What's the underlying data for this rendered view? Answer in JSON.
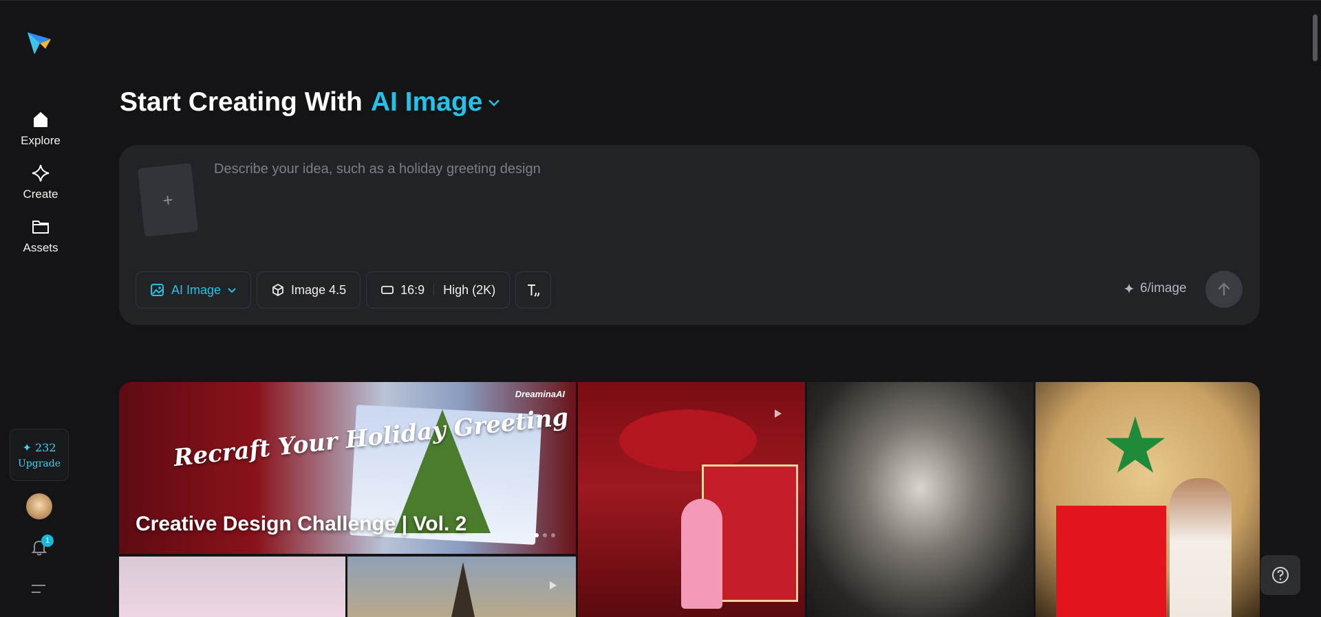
{
  "nav": {
    "items": [
      {
        "label": "Explore",
        "icon": "home-icon"
      },
      {
        "label": "Create",
        "icon": "sparkle-icon"
      },
      {
        "label": "Assets",
        "icon": "folder-icon"
      }
    ]
  },
  "account": {
    "credits": "✦ 232",
    "upgrade_label": "Upgrade",
    "notification_count": "1"
  },
  "header": {
    "title_prefix": "Start Creating With",
    "title_mode": "AI Image"
  },
  "composer": {
    "placeholder": "Describe your idea, such as a holiday greeting design",
    "upload_label": "+",
    "mode_label": "AI Image",
    "model_label": "Image 4.5",
    "ratio_label": "16:9",
    "quality_label": "High (2K)",
    "cost_label": "6/image"
  },
  "gallery": {
    "banner_script": "Recraft Your Holiday Greeting",
    "banner_brand": "DreaminaAI",
    "banner_caption": "Creative Design Challenge | Vol. 2"
  },
  "colors": {
    "background": "#141416",
    "accent": "#22c3e6",
    "panel": "#222327"
  }
}
